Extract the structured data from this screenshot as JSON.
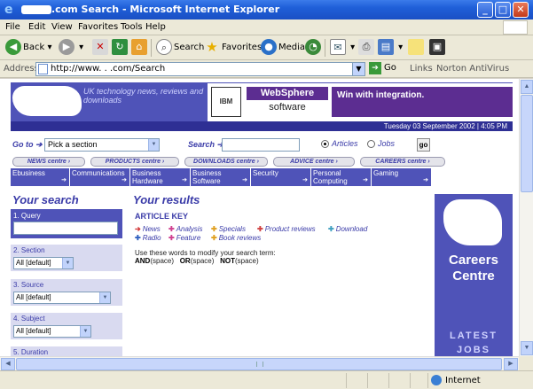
{
  "window": {
    "title_suffix": ".com Search - Microsoft Internet Explorer",
    "minimize": "_",
    "maximize": "□",
    "close": "✕"
  },
  "menu": [
    "File",
    "Edit",
    "View",
    "Favorites",
    "Tools",
    "Help"
  ],
  "toolbar": {
    "back": "Back",
    "search": "Search",
    "favorites": "Favorites",
    "media": "Media"
  },
  "address": {
    "label": "Address",
    "url": "http://www.   .    .com/Search",
    "go": "Go",
    "links": "Links",
    "norton": "Norton AntiVirus"
  },
  "status": {
    "zone": "Internet"
  },
  "page": {
    "tagline": "UK technology news, reviews and downloads",
    "ad": {
      "brand": "IBM",
      "ws_top": "WebSphere",
      "ws_bottom": "software",
      "slogan": "Win with integration."
    },
    "date": "Tuesday 03 September 2002 | 4:05 PM",
    "goto_label": "Go to ➔",
    "goto_select": "Pick a section",
    "search_label": "Search ➔",
    "radio_articles": "Articles",
    "radio_jobs": "Jobs",
    "go_btn": "go",
    "centres": [
      "NEWS centre ›",
      "PRODUCTS centre ›",
      "DOWNLOADS centre ›",
      "ADVICE centre ›",
      "CAREERS centre ›"
    ],
    "sections": [
      "Ebusiness",
      "Communications",
      "Business Hardware",
      "Business Software",
      "Security",
      "Personal Computing",
      "Gaming"
    ],
    "your_search": "Your search",
    "query_label": "1. Query",
    "section_label": "2. Section",
    "section_value": "All [default]",
    "source_label": "3. Source",
    "source_value": "All [default]",
    "subject_label": "4. Subject",
    "subject_value": "All [default]",
    "duration_label": "5. Duration",
    "your_results": "Your results",
    "article_key": "ARTICLE KEY",
    "keys_row1": [
      "News",
      "Analysis",
      "Specials",
      "Product reviews",
      "Download"
    ],
    "keys_row2": [
      "Radio",
      "Feature",
      "Book reviews"
    ],
    "hint": "Use these words to modify your search term:",
    "op_and": "AND",
    "op_and_s": "(space)",
    "op_or": "OR",
    "op_or_s": "(space)",
    "op_not": "NOT",
    "op_not_s": "(space)",
    "careers_title": "Careers Centre",
    "latest_jobs": "LATEST JOBS"
  },
  "colors": {
    "brand_blue": "#4f53b8",
    "dark_blue": "#2e2f94",
    "text_blue": "#3a3ba8",
    "ie_blue": "#1f5fd8"
  }
}
